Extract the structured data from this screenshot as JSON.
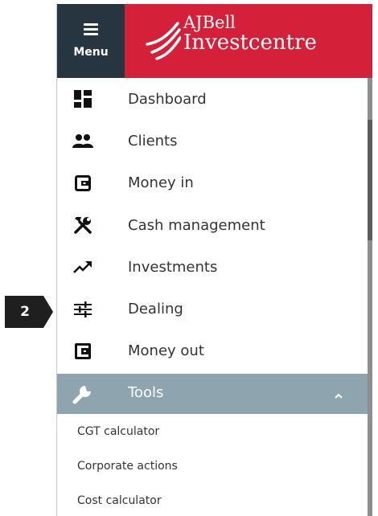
{
  "callout": {
    "number": "2",
    "color": "#1f1f1f"
  },
  "header": {
    "menu_label": "Menu",
    "brand_line1": "AJBell",
    "brand_line2": "Investcentre",
    "brand_color": "#d5203a",
    "menu_bg": "#273540"
  },
  "nav": {
    "items": [
      {
        "label": "Dashboard",
        "icon": "dashboard-icon"
      },
      {
        "label": "Clients",
        "icon": "people-icon"
      },
      {
        "label": "Money in",
        "icon": "wallet-icon"
      },
      {
        "label": "Cash management",
        "icon": "tools-icon"
      },
      {
        "label": "Investments",
        "icon": "trending-up-icon"
      },
      {
        "label": "Dealing",
        "icon": "sliders-icon"
      },
      {
        "label": "Money out",
        "icon": "wallet-out-icon"
      }
    ],
    "tools": {
      "label": "Tools",
      "icon": "wrench-icon",
      "expanded": true,
      "bg": "#8ea4ae",
      "items": [
        {
          "label": "CGT calculator"
        },
        {
          "label": "Corporate actions"
        },
        {
          "label": "Cost calculator"
        }
      ]
    }
  }
}
